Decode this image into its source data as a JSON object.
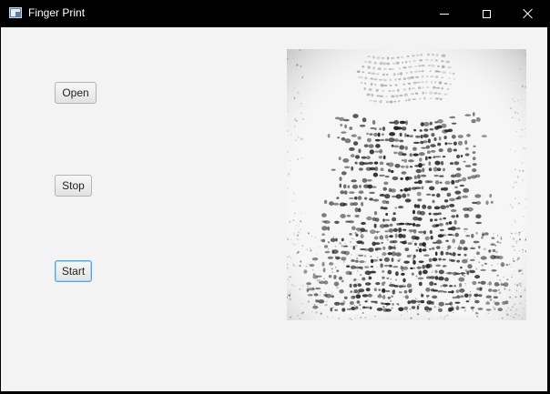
{
  "window": {
    "title": "Finger Print",
    "icon": "app-window-icon",
    "controls": {
      "minimize": "minimize-icon",
      "maximize": "maximize-icon",
      "close": "close-icon"
    }
  },
  "buttons": {
    "open": "Open",
    "stop": "Stop",
    "start": "Start"
  },
  "image": {
    "subject": "fingerprint"
  },
  "colors": {
    "titlebar": "#000000",
    "client_background": "#f3f3f3",
    "focus_border": "#4ea6dc",
    "ridge": "#1a1a1a"
  }
}
